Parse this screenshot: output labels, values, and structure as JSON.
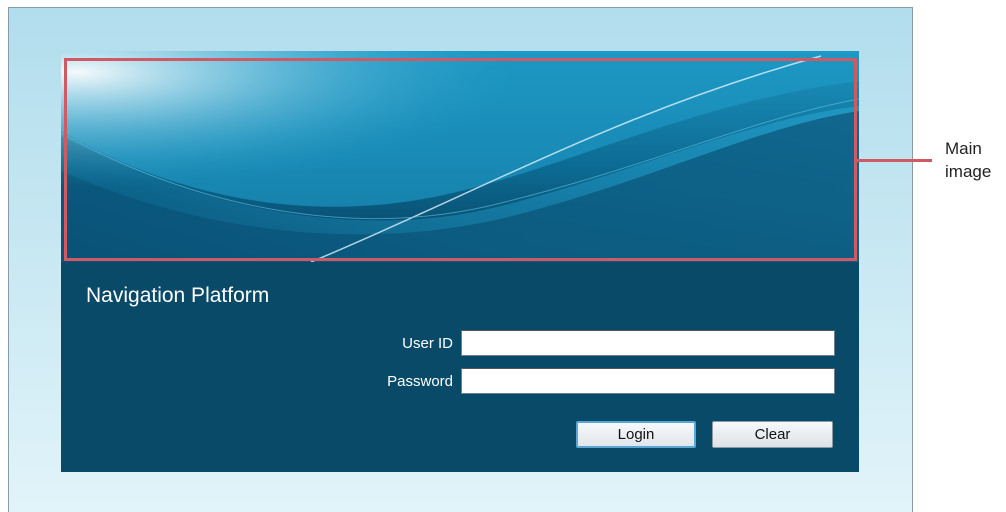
{
  "login": {
    "title": "Navigation Platform",
    "user_id_label": "User ID",
    "user_id_value": "",
    "password_label": "Password",
    "password_value": "",
    "login_label": "Login",
    "clear_label": "Clear"
  },
  "annotation": {
    "line1": "Main",
    "line2": "image",
    "color": "#cf5a63"
  },
  "colors": {
    "panel": "#0a4a69",
    "banner_light": "#2aa7d0",
    "page_background": "#b2dded"
  }
}
